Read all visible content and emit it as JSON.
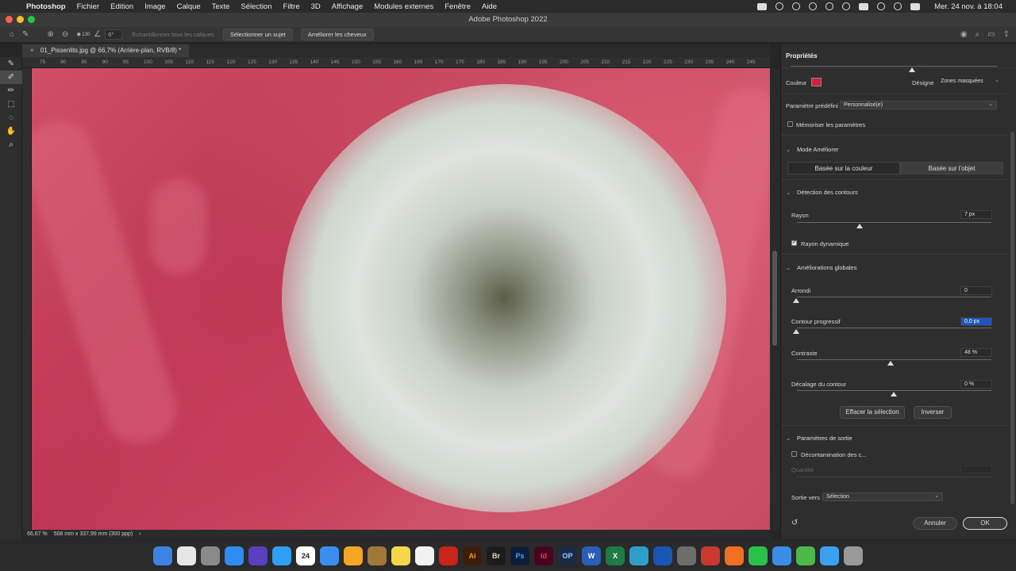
{
  "menubar": {
    "app": "Photoshop",
    "items": [
      "Fichier",
      "Edition",
      "Image",
      "Calque",
      "Texte",
      "Sélection",
      "Filtre",
      "3D",
      "Affichage",
      "Modules externes",
      "Fenêtre",
      "Aide"
    ],
    "clock": "Mer. 24 nov. à  18:04"
  },
  "window": {
    "title": "Adobe Photoshop 2022"
  },
  "options_bar": {
    "brush_size": "130",
    "angle": "0°",
    "sample_all_layers": "Echantillonner tous les calques",
    "select_subject": "Sélectionner un sujet",
    "refine_hair": "Améliorer les cheveux"
  },
  "document": {
    "tab_label": "01_Pissenlits.jpg @ 66,7% (Arrière-plan, RVB/8) *",
    "ruler_ticks": [
      "75",
      "80",
      "85",
      "90",
      "95",
      "100",
      "105",
      "110",
      "115",
      "120",
      "125",
      "130",
      "135",
      "140",
      "145",
      "150",
      "155",
      "160",
      "165",
      "170",
      "175",
      "180",
      "185",
      "190",
      "195",
      "200",
      "205",
      "210",
      "215",
      "220",
      "225",
      "230",
      "235",
      "240",
      "245"
    ],
    "zoom": "66,67 %",
    "dimensions": "508 mm x 337,99 mm (300 ppp)"
  },
  "properties": {
    "title": "Propriétés",
    "color_label": "Couleur",
    "color_value": "#d0213f",
    "designates_label": "Désigne",
    "designates_value": "Zones masquées",
    "preset_label": "Paramètre prédéfini",
    "preset_value": "Personnalisé(e)",
    "remember_label": "Mémoriser les paramètres",
    "mode_section": "Mode Améliorer",
    "mode_color": "Basée sur la couleur",
    "mode_object": "Basée sur l'objet",
    "edge_section": "Détection des contours",
    "radius_label": "Rayon",
    "radius_value": "7 px",
    "smart_radius_label": "Rayon dynamique",
    "global_section": "Améliorations globales",
    "smooth_label": "Arrondi",
    "smooth_value": "0",
    "feather_label": "Contour progressif",
    "feather_value": "0,0 px",
    "contrast_label": "Contraste",
    "contrast_value": "48 %",
    "shift_label": "Décalage du contour",
    "shift_value": "0 %",
    "clear_selection": "Effacer la sélection",
    "invert": "Inverser",
    "output_section": "Paramètres de sortie",
    "decontaminate_label": "Décontamination des c...",
    "amount_label": "Quantité",
    "output_to_label": "Sortie vers",
    "output_to_value": "Sélection",
    "cancel": "Annuler",
    "ok": "OK"
  },
  "dock": {
    "calendar_day": "24",
    "apps": [
      "Ai",
      "Br",
      "Ps",
      "Id",
      "OP",
      "W",
      "X"
    ]
  }
}
